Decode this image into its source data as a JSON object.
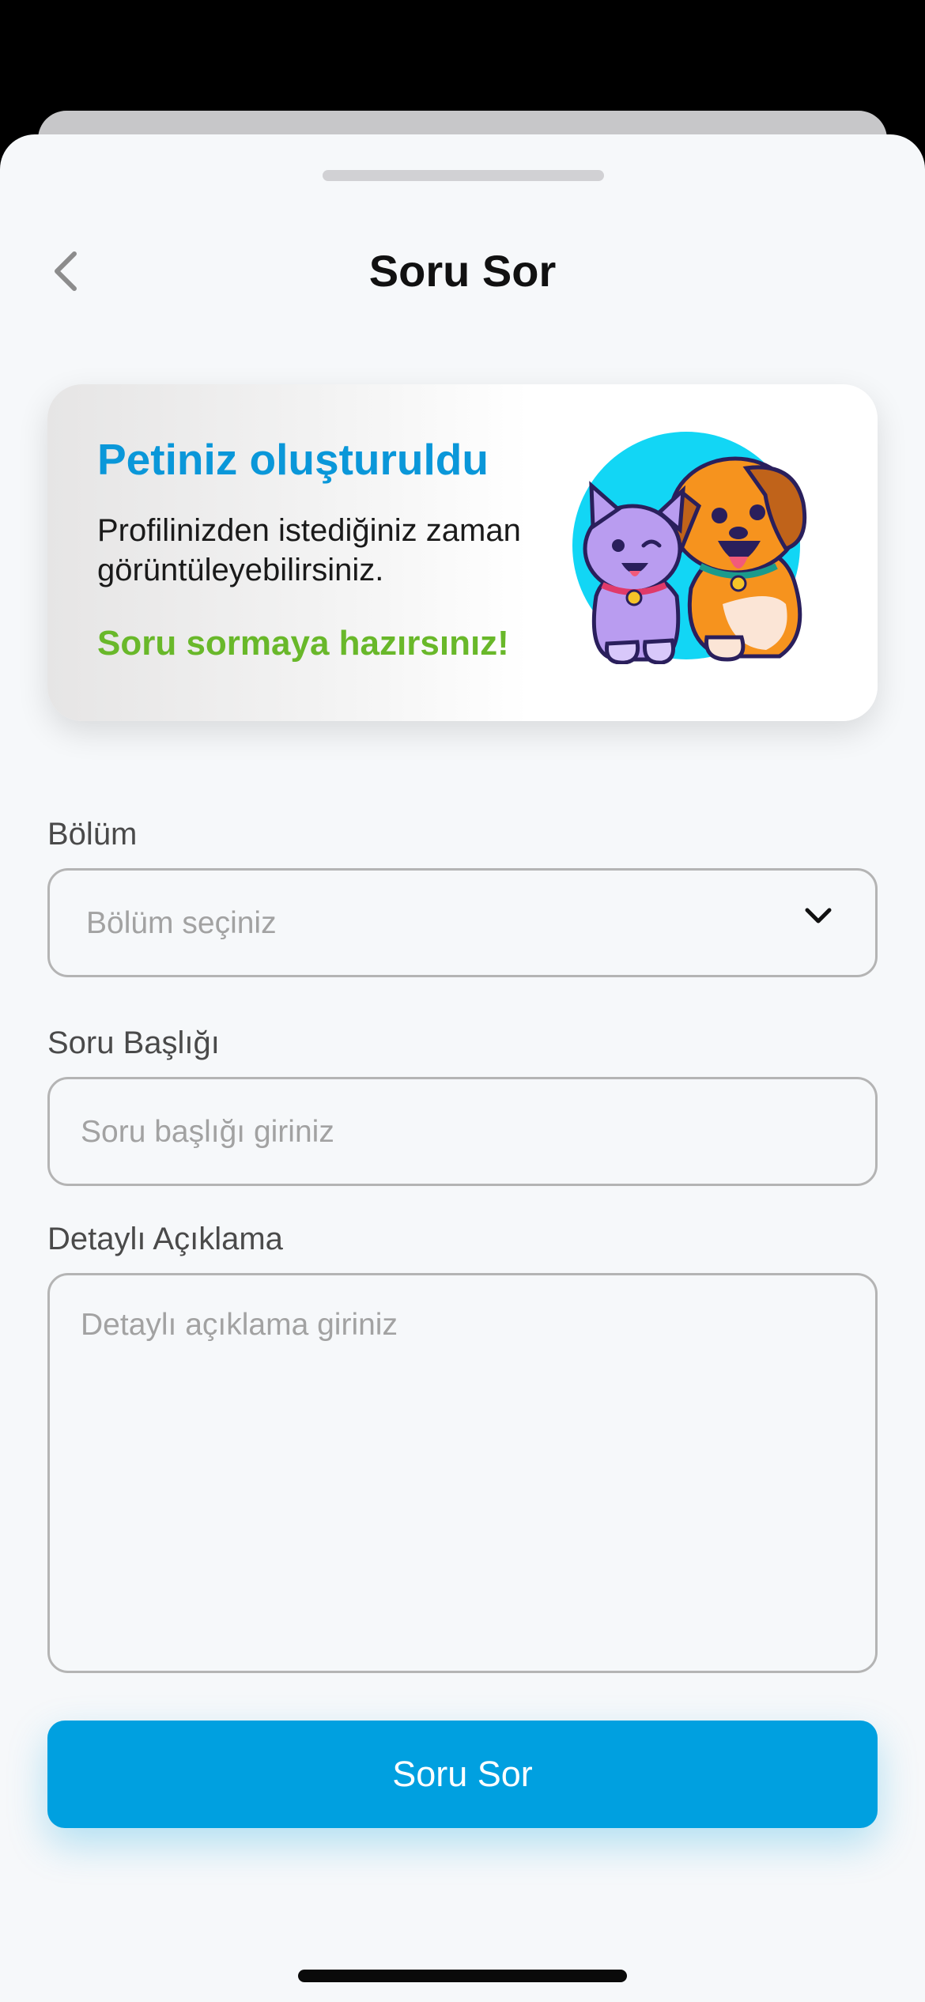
{
  "header": {
    "title": "Soru Sor"
  },
  "banner": {
    "title": "Petiniz oluşturuldu",
    "text": "Profilinizden istediğiniz zaman görüntüleyebilirsiniz.",
    "cta": "Soru sormaya hazırsınız!"
  },
  "form": {
    "section": {
      "label": "Bölüm",
      "placeholder": "Bölüm seçiniz"
    },
    "title": {
      "label": "Soru Başlığı",
      "placeholder": "Soru başlığı giriniz"
    },
    "description": {
      "label": "Detaylı Açıklama",
      "placeholder": "Detaylı açıklama giriniz"
    }
  },
  "submit_label": "Soru Sor",
  "icons": {
    "back": "chevron-left-icon",
    "dropdown": "chevron-down-icon",
    "illustration": "cat-and-dog-illustration"
  },
  "colors": {
    "accent": "#00a0e0",
    "banner_title": "#0a97d9",
    "banner_cta": "#69b82a",
    "illustration_circle": "#12d6f5"
  }
}
